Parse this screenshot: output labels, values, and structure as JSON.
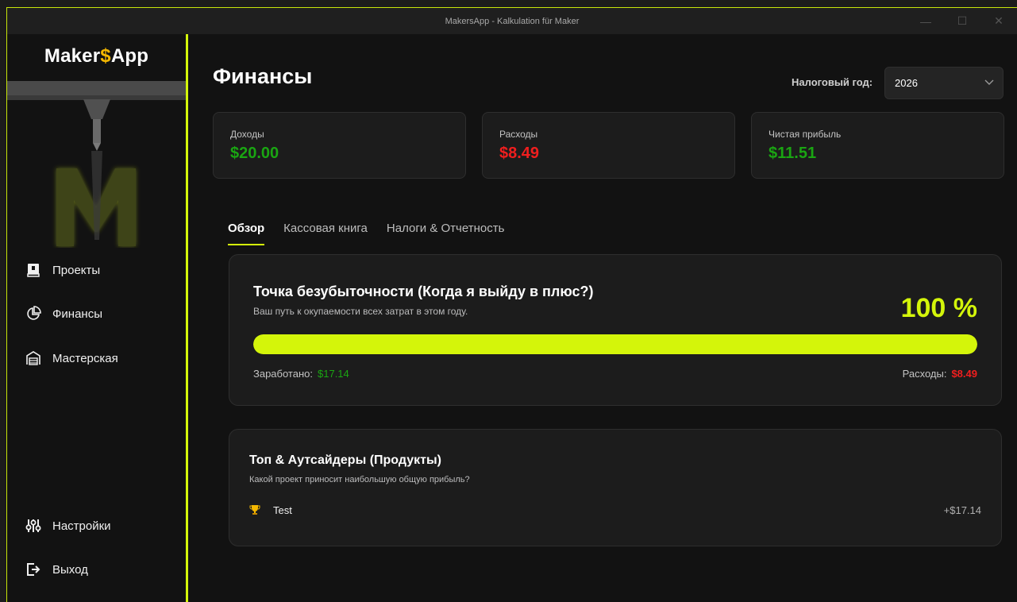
{
  "window": {
    "title": "MakersApp - Kalkulation für Maker",
    "minimize": "—",
    "maximize": "☐",
    "close": "✕"
  },
  "sidebar": {
    "logo_prefix": "Maker",
    "logo_dollar": "$",
    "logo_suffix": "App",
    "items": [
      {
        "label": "Проекты",
        "icon": "book-icon"
      },
      {
        "label": "Финансы",
        "icon": "pie-chart-icon"
      },
      {
        "label": "Мастерская",
        "icon": "warehouse-icon"
      },
      {
        "label": "Настройки",
        "icon": "sliders-icon"
      },
      {
        "label": "Выход",
        "icon": "logout-icon"
      }
    ]
  },
  "header": {
    "title": "Финансы",
    "tax_year_label": "Налоговый год:",
    "tax_year_value": "2026"
  },
  "kpis": [
    {
      "label": "Доходы",
      "value": "$20.00",
      "color": "#1aa512"
    },
    {
      "label": "Расходы",
      "value": "$8.49",
      "color": "#f01e1e"
    },
    {
      "label": "Чистая прибыль",
      "value": "$11.51",
      "color": "#1aa512"
    }
  ],
  "tabs": [
    {
      "label": "Обзор",
      "active": true
    },
    {
      "label": "Кассовая книга",
      "active": false
    },
    {
      "label": "Налоги & Отчетность",
      "active": false
    }
  ],
  "breakeven": {
    "title": "Точка безубыточности (Когда я выйду в плюс?)",
    "subtitle": "Ваш путь к окупаемости всех затрат в этом году.",
    "percent_label": "100 %",
    "progress": 1.0,
    "earned_label": "Заработано:",
    "earned_value": "$17.14",
    "expenses_label": "Расходы:",
    "expenses_value": "$8.49"
  },
  "top_products": {
    "title": "Топ & Аутсайдеры (Продукты)",
    "subtitle": "Какой проект приносит наибольшую общую прибыль?",
    "rows": [
      {
        "icon": "trophy-icon",
        "name": "Test",
        "value": "+$17.14"
      }
    ]
  },
  "colors": {
    "accent": "#d4f50a",
    "positive": "#1aa512",
    "negative": "#f01e1e"
  }
}
